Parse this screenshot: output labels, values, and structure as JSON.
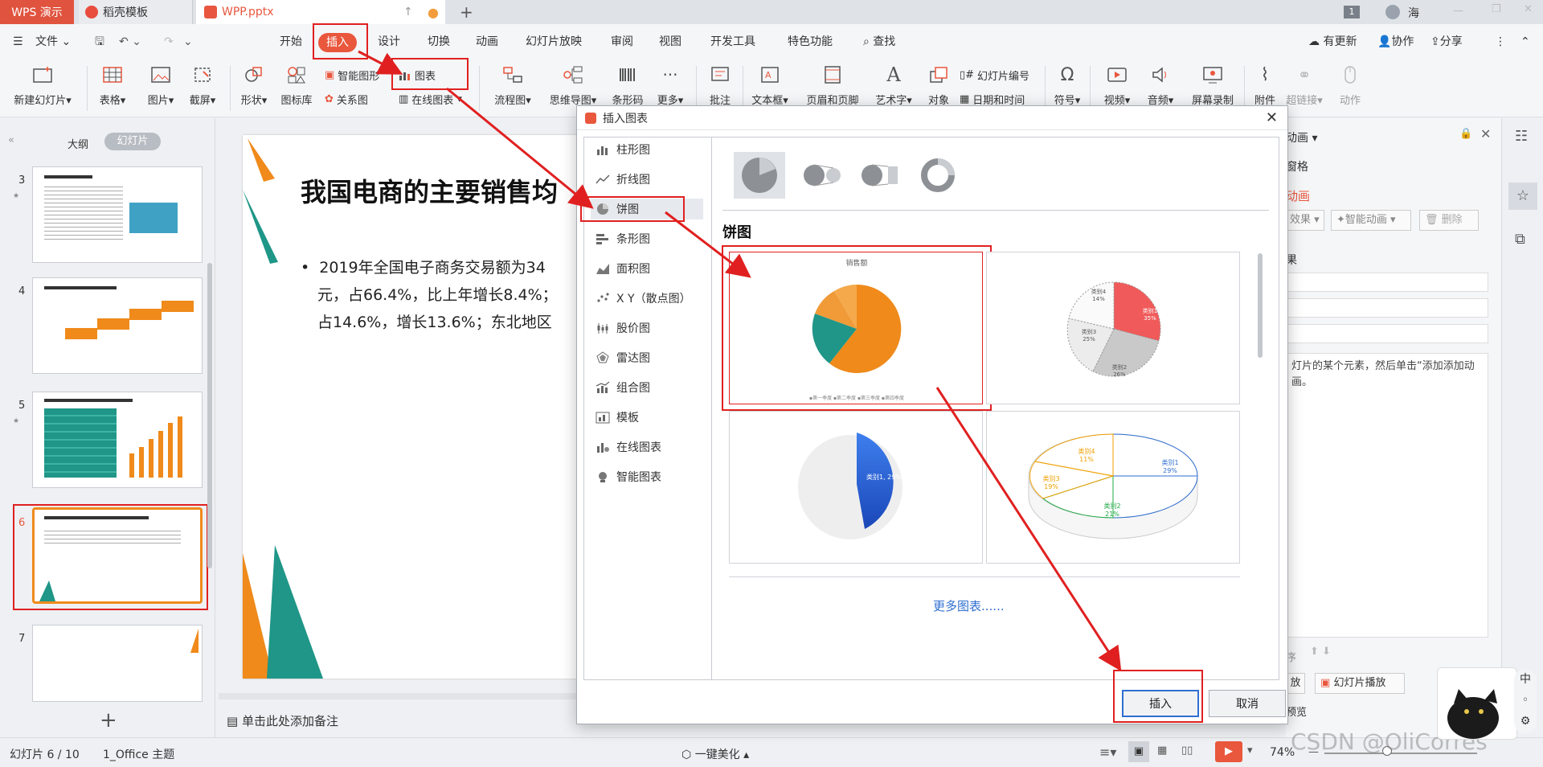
{
  "tabs": {
    "app": "WPS 演示",
    "template": "稻壳模板",
    "document": "WPP.pptx"
  },
  "user": {
    "badge": "1",
    "name": "海"
  },
  "menu": {
    "file": "文件",
    "items": [
      "开始",
      "插入",
      "设计",
      "切换",
      "动画",
      "幻灯片放映",
      "审阅",
      "视图",
      "开发工具",
      "特色功能"
    ],
    "search": "查找",
    "update": "有更新",
    "collab": "协作",
    "share": "分享"
  },
  "ribbon": {
    "new_slide": "新建幻灯片",
    "table": "表格",
    "picture": "图片",
    "screenshot": "截屏",
    "shape": "形状",
    "icon_lib": "图标库",
    "smart_shape": "智能图形",
    "chart": "图表",
    "relation": "关系图",
    "online_chart": "在线图表",
    "flowchart": "流程图",
    "mindmap": "思维导图",
    "barcode": "条形码",
    "more": "更多",
    "comment": "批注",
    "textbox": "文本框",
    "header_footer": "页眉和页脚",
    "wordart": "艺术字",
    "object": "对象",
    "slide_number": "幻灯片编号",
    "datetime": "日期和时间",
    "symbol": "符号",
    "video": "视频",
    "audio": "音频",
    "screen_record": "屏幕录制",
    "attachment": "附件",
    "hyperlink": "超链接",
    "action": "动作"
  },
  "left_panel": {
    "tab_outline": "大纲",
    "tab_slides": "幻灯片",
    "slide_numbers": [
      "3",
      "4",
      "5",
      "6",
      "7"
    ],
    "add": "+"
  },
  "slide": {
    "title": "我国电商的主要销售均",
    "bullet_line1": "2019年全国电子商务交易额为34",
    "bullet_line2": "元，占66.4%，比上年增长8.4%；",
    "bullet_line3": "占14.6%，增长13.6%；东北地区"
  },
  "notes_placeholder": "单击此处添加备注",
  "dialog": {
    "title": "插入图表",
    "categories": [
      "柱形图",
      "折线图",
      "饼图",
      "条形图",
      "面积图",
      "X Y（散点图）",
      "股价图",
      "雷达图",
      "组合图",
      "模板",
      "在线图表",
      "智能图表"
    ],
    "selected_category": "饼图",
    "section_title": "饼图",
    "more_charts": "更多图表......",
    "insert_button": "插入",
    "cancel_button": "取消",
    "preview1": {
      "title": "销售额",
      "legend": "▪第一季度 ▪第二季度 ▪第三季度 ▪第四季度"
    },
    "preview2": {
      "labels": [
        "类别1 35%",
        "类别2 26%",
        "类别3 25%",
        "类别4 14%"
      ]
    },
    "preview3": {
      "label": "类别1, 29%"
    },
    "preview4": {
      "labels": [
        "类别1 29%",
        "类别2 21%",
        "类别3 19%",
        "类别4 11%"
      ]
    }
  },
  "right_panel": {
    "header": "动画",
    "pane": "窗格",
    "custom_animation": "动画",
    "effect": "效果",
    "smart_anim": "智能动画",
    "delete": "删除",
    "modify": "果",
    "hint": "灯片的某个元素，然后单击“添加添加动画。",
    "reorder": "序",
    "play": "放",
    "slideshow": "幻灯片播放",
    "preview": "预览"
  },
  "status": {
    "slide_count": "幻灯片 6 / 10",
    "theme": "1_Office 主题",
    "beautify": "一键美化",
    "zoom": "74%",
    "watermark": "CSDN @OliCorres"
  },
  "colors": {
    "accent": "#e9573d",
    "teal": "#1f9687",
    "orange": "#ef8a1b",
    "annotation": "#e02020",
    "link": "#2f6fd1"
  }
}
